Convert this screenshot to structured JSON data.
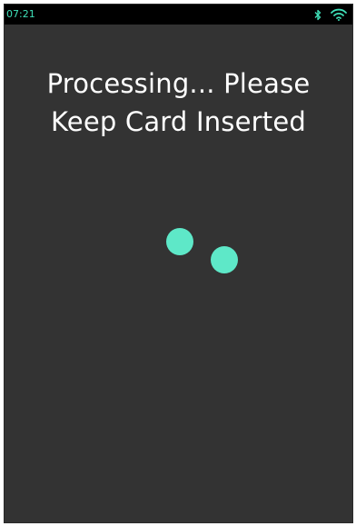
{
  "status_bar": {
    "time": "07:21",
    "icons": [
      "bluetooth-icon",
      "wifi-icon"
    ],
    "accent_color": "#3fe0b8"
  },
  "screen": {
    "message_line1": "Processing... Please",
    "message_line2": "Keep Card Inserted",
    "background_color": "#333333",
    "text_color": "#ffffff"
  },
  "loader": {
    "dot_color": "#5ee8c8",
    "dot_count": 2
  }
}
